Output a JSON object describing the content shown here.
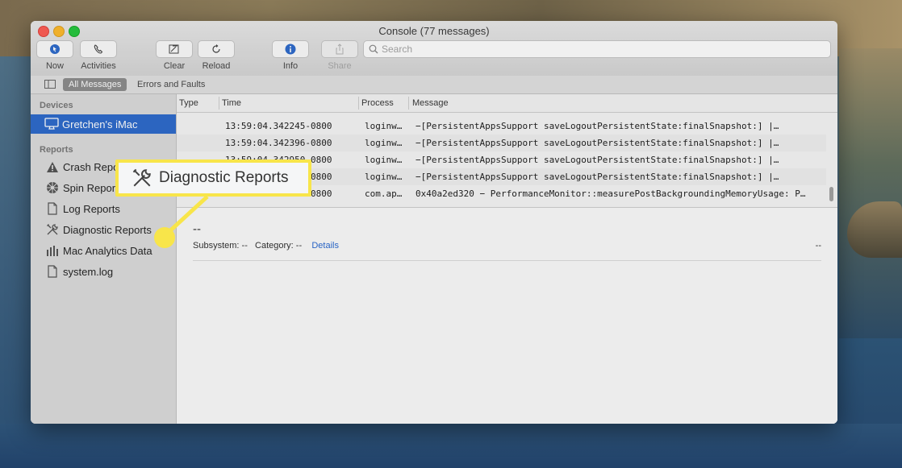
{
  "window": {
    "title": "Console (77 messages)"
  },
  "toolbar": {
    "now_label": "Now",
    "activities_label": "Activities",
    "clear_label": "Clear",
    "reload_label": "Reload",
    "info_label": "Info",
    "share_label": "Share",
    "search_placeholder": "Search"
  },
  "filters": {
    "all_messages": "All Messages",
    "errors_and_faults": "Errors and Faults"
  },
  "sidebar": {
    "devices_header": "Devices",
    "device": {
      "label": "Gretchen's iMac",
      "icon": "imac-icon"
    },
    "reports_header": "Reports",
    "items": [
      {
        "label": "Crash Reports",
        "icon": "warning-icon"
      },
      {
        "label": "Spin Reports",
        "icon": "spin-icon"
      },
      {
        "label": "Log Reports",
        "icon": "document-icon"
      },
      {
        "label": "Diagnostic Reports",
        "icon": "tools-icon"
      },
      {
        "label": "Mac Analytics Data",
        "icon": "bar-chart-icon"
      },
      {
        "label": "system.log",
        "icon": "document-icon"
      }
    ]
  },
  "table": {
    "columns": [
      "Type",
      "Time",
      "Process",
      "Message"
    ],
    "rows": [
      {
        "type": "",
        "time": "13:59:04.342245-0800",
        "process": "loginw…",
        "message": "−[PersistentAppsSupport saveLogoutPersistentState:finalSnapshot:] |…"
      },
      {
        "type": "",
        "time": "13:59:04.342396-0800",
        "process": "loginw…",
        "message": "−[PersistentAppsSupport saveLogoutPersistentState:finalSnapshot:] |…"
      },
      {
        "type": "",
        "time": "13:59:04.342950-0800",
        "process": "loginw…",
        "message": "−[PersistentAppsSupport saveLogoutPersistentState:finalSnapshot:] |…"
      },
      {
        "type": "",
        "time": "13:59:04.343014-0800",
        "process": "loginw…",
        "message": "−[PersistentAppsSupport saveLogoutPersistentState:finalSnapshot:] |…"
      },
      {
        "type": "",
        "time": "13:59:04.343101-0800",
        "process": "com.ap…",
        "message": "0x40a2ed320 − PerformanceMonitor::measurePostBackgroundingMemoryUsage: P…"
      }
    ]
  },
  "detail": {
    "title": "--",
    "subsystem_label": "Subsystem:",
    "subsystem_value": "--",
    "category_label": "Category:",
    "category_value": "--",
    "details_link": "Details",
    "right_value": "--"
  },
  "callout": {
    "label": "Diagnostic Reports",
    "icon": "tools-icon",
    "accent": "#f8e54a"
  }
}
